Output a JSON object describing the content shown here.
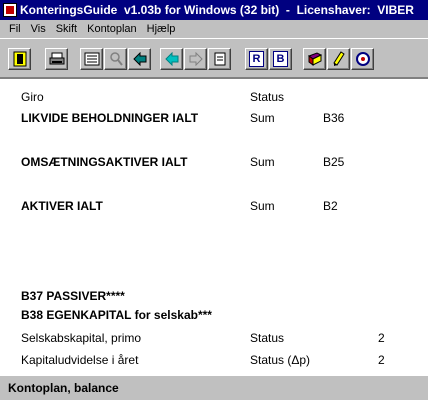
{
  "window": {
    "title": "KonteringsGuide  v1.03b for Windows (32 bit)  -  Licenshaver:  VIBER"
  },
  "menu": [
    "Fil",
    "Vis",
    "Skift",
    "Kontoplan",
    "Hjælp"
  ],
  "toolbar": {
    "buttons": [
      "exit-door-icon",
      "print-icon",
      "list-icon",
      "search-icon",
      "back-icon",
      "prev-icon",
      "next-icon",
      "page-icon",
      "r-icon",
      "b-icon",
      "book-icon",
      "pencil-icon",
      "help-icon"
    ],
    "r_label": "R",
    "b_label": "B"
  },
  "table": {
    "header": {
      "col1": "Giro",
      "col2": "Status"
    },
    "rows": [
      {
        "label": "LIKVIDE BEHOLDNINGER IALT",
        "status": "Sum",
        "ref": "B36",
        "bold": true
      },
      {
        "label": "OMSÆTNINGSAKTIVER IALT",
        "status": "Sum",
        "ref": "B25",
        "bold": true
      },
      {
        "label": "AKTIVER IALT",
        "status": "Sum",
        "ref": "B2",
        "bold": true
      },
      {
        "label": "B37  PASSIVER****",
        "status": "",
        "ref": "",
        "bold": true
      },
      {
        "label": "B38  EGENKAPITAL for selskab***",
        "status": "",
        "ref": "",
        "bold": true
      },
      {
        "label": "Selskabskapital, primo",
        "status": "Status",
        "ref": "2",
        "bold": false
      },
      {
        "label": "Kapitaludvidelse i året",
        "status": "Status (Δp)",
        "ref": "2",
        "bold": false
      }
    ]
  },
  "status": {
    "text": "Kontoplan, balance"
  }
}
